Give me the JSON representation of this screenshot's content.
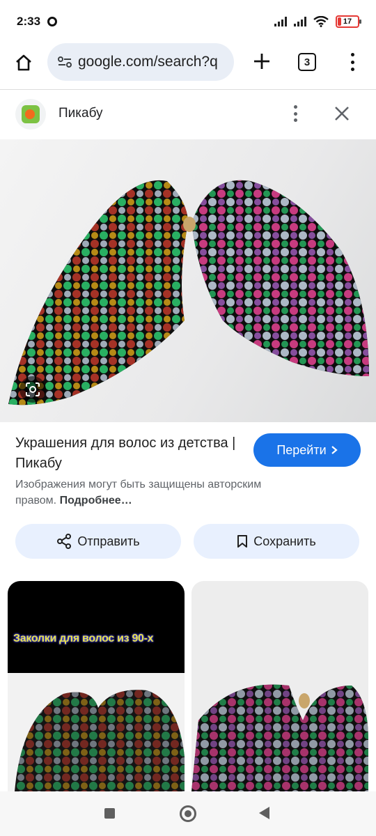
{
  "status_bar": {
    "time": "2:33",
    "battery_level": "17"
  },
  "browser": {
    "url": "google.com/search?q",
    "tab_count": "3",
    "icons": [
      "home-icon",
      "site-info-icon",
      "new-tab-icon",
      "tab-switcher-icon",
      "overflow-menu-icon"
    ]
  },
  "source": {
    "name": "Пикабу",
    "icons": [
      "pikabu-favicon",
      "more-vert-icon",
      "close-icon"
    ]
  },
  "result": {
    "title": "Украшения для волос из детства | Пикабу",
    "visit_label": "Перейти",
    "copyright_text": "Изображения могут быть защищены авторским правом.",
    "more_link": "Подробнее…",
    "share_label": "Отправить",
    "save_label": "Сохранить",
    "accent_color": "#1a73e8"
  },
  "related": {
    "thumb_1_caption": "Заколки для волос из 90-х"
  }
}
